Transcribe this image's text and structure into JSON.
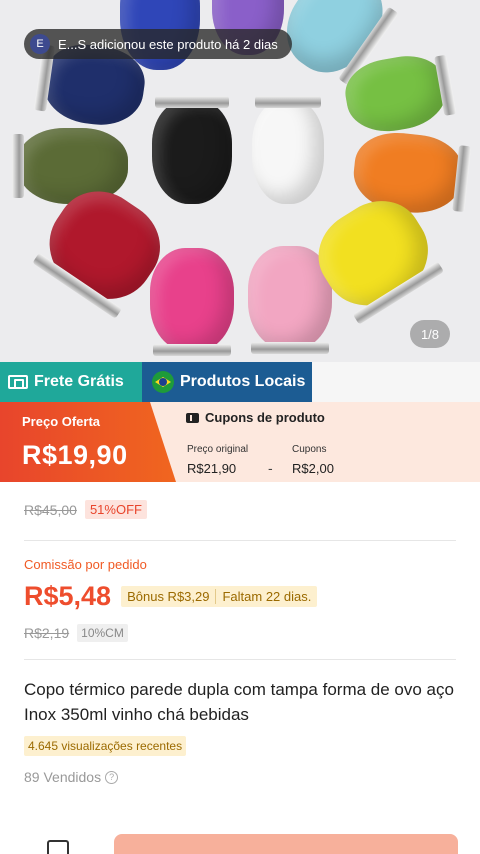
{
  "notice": {
    "avatar_letter": "E",
    "text": "E...S adicionou este produto há 2 dias"
  },
  "gallery": {
    "counter": "1/8"
  },
  "badges": {
    "free_shipping": "Frete Grátis",
    "local_products": "Produtos Locais"
  },
  "offer": {
    "label": "Preço Oferta",
    "price": "R$19,90"
  },
  "coupons": {
    "header": "Cupons de produto",
    "original_label": "Preço original",
    "original_value": "R$21,90",
    "minus": "-",
    "coupons_label": "Cupons",
    "coupons_value": "R$2,00"
  },
  "pricing": {
    "old_price": "R$45,00",
    "discount": "51%OFF"
  },
  "commission": {
    "label": "Comissão por pedido",
    "value": "R$5,48",
    "bonus": "Bônus R$3,29",
    "remaining": "Faltam 22 dias.",
    "old_value": "R$2,19",
    "rate": "10%CM"
  },
  "product": {
    "title": "Copo térmico parede dupla com tampa forma de ovo aço Inox 350ml vinho chá bebidas",
    "views": "4.645 visualizações recentes",
    "sold": "89 Vendidos"
  },
  "colors": {
    "offer_gradient_start": "#e8452c",
    "free_shipping_bg": "#1fa89a",
    "local_products_bg": "#1c5c93",
    "commission_color": "#ee4d2d"
  }
}
